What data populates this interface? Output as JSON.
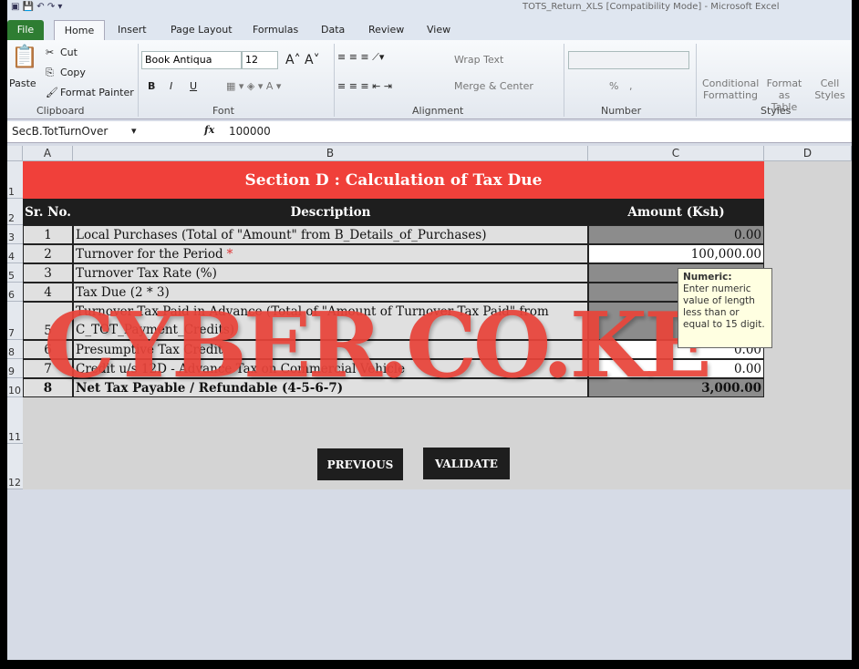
{
  "window": {
    "title": "TOTS_Return_XLS [Compatibility Mode] - Microsoft Excel"
  },
  "tabs": [
    "File",
    "Home",
    "Insert",
    "Page Layout",
    "Formulas",
    "Data",
    "Review",
    "View"
  ],
  "ribbon": {
    "clipboard": {
      "paste": "Paste",
      "cut": "Cut",
      "copy": "Copy",
      "format_painter": "Format Painter",
      "label": "Clipboard"
    },
    "font": {
      "name": "Book Antiqua",
      "size": "12",
      "label": "Font",
      "bold": "B",
      "italic": "I",
      "underline": "U"
    },
    "alignment": {
      "wrap": "Wrap Text",
      "merge": "Merge & Center",
      "label": "Alignment"
    },
    "number": {
      "label": "Number",
      "percent": "%",
      "comma": ","
    },
    "styles": {
      "conditional": "Conditional Formatting",
      "format_table": "Format as Table",
      "cell_styles": "Cell Styles",
      "label": "Styles"
    }
  },
  "formula_bar": {
    "name_box": "SecB.TotTurnOver",
    "fx": "fx",
    "value": "100000"
  },
  "columns": [
    "A",
    "B",
    "C",
    "D"
  ],
  "rows": [
    "1",
    "2",
    "3",
    "4",
    "5",
    "6",
    "7",
    "8",
    "9",
    "10",
    "11",
    "12"
  ],
  "sheet": {
    "title": "Section D : Calculation of Tax Due",
    "headers": {
      "sr": "Sr. No.",
      "desc": "Description",
      "amount": "Amount (Ksh)"
    },
    "items": [
      {
        "sr": "1",
        "desc": "Local Purchases (Total of \"Amount\" from B_Details_of_Purchases)",
        "amount": "0.00",
        "editable": false
      },
      {
        "sr": "2",
        "desc": "Turnover for the Period",
        "required": "*",
        "amount": "100,000.00",
        "editable": true
      },
      {
        "sr": "3",
        "desc": "Turnover Tax Rate (%)",
        "amount": "",
        "editable": false
      },
      {
        "sr": "4",
        "desc": "Tax Due (2 * 3)",
        "amount": "",
        "editable": false
      },
      {
        "sr": "5",
        "desc": "Turnover Tax Paid in Advance (Total of \"Amount of Turnover Tax Paid\" from",
        "desc2": "C_TOT_Payment_Credits)",
        "amount": "",
        "editable": false
      },
      {
        "sr": "6",
        "desc": "Presumptive Tax Credit",
        "amount": "0.00",
        "editable": true
      },
      {
        "sr": "7",
        "desc": "Credit u/s 12D - Advance Tax on Commercial Vehicle",
        "amount": "0.00",
        "editable": true
      },
      {
        "sr": "8",
        "desc": "Net Tax Payable / Refundable (4-5-6-7)",
        "amount": "3,000.00",
        "editable": false
      }
    ],
    "buttons": {
      "previous": "PREVIOUS",
      "validate": "VALIDATE"
    }
  },
  "tooltip": {
    "title": "Numeric:",
    "body": "Enter numeric value of length less than or equal to 15 digit."
  },
  "watermark": "CYBER.CO.KE",
  "colors": {
    "title_bg": "#f0403a",
    "header_bg": "#1e1e1e",
    "locked_cell": "#8c8c8c",
    "watermark": "#e8443a"
  }
}
